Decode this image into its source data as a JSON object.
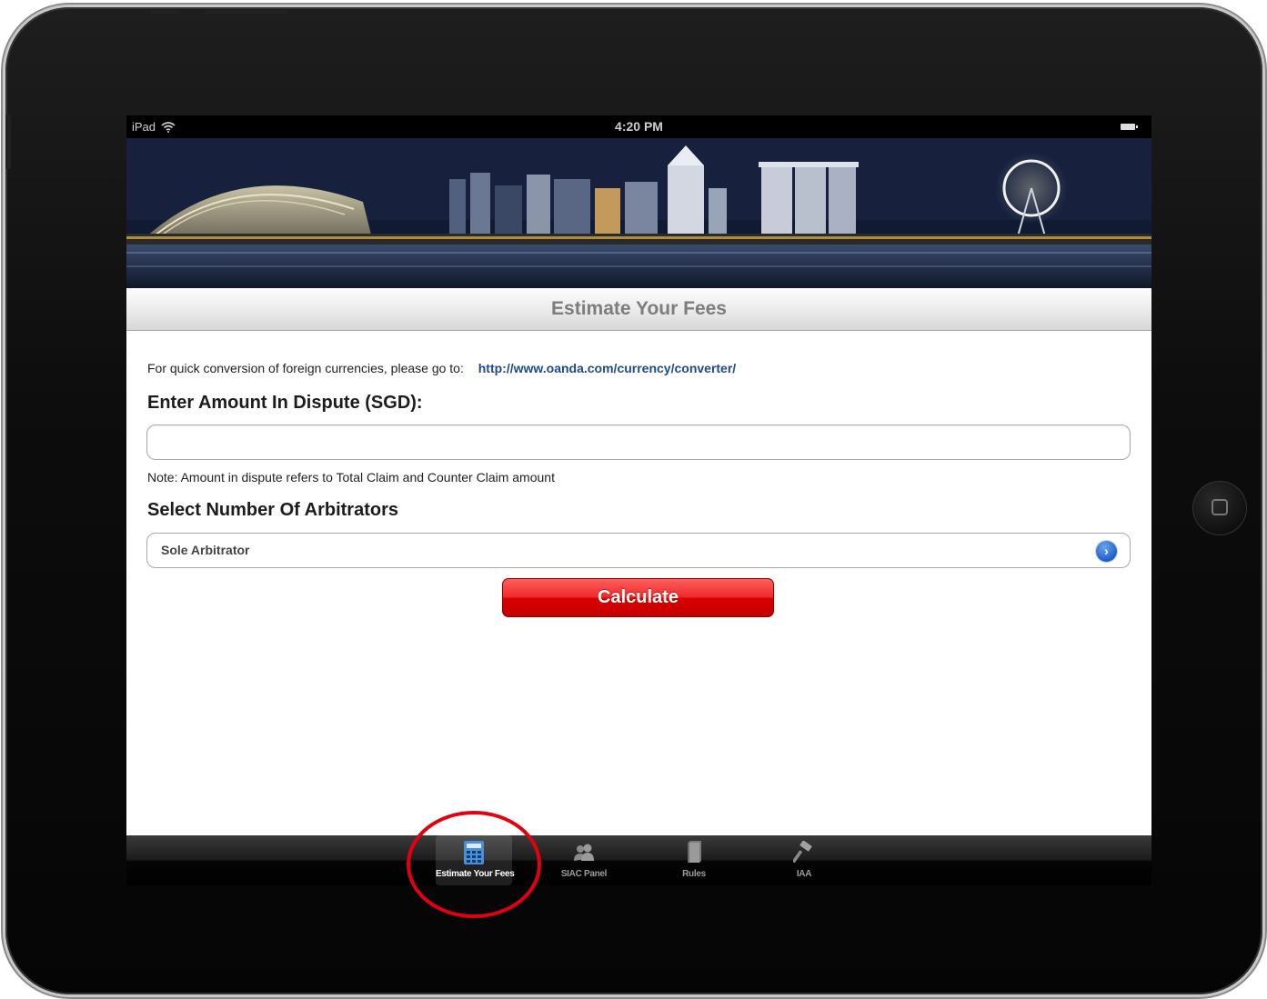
{
  "status_bar": {
    "carrier": "iPad",
    "time": "4:20 PM"
  },
  "header": {
    "title": "Estimate Your Fees"
  },
  "form": {
    "currency_note": "For quick conversion of foreign currencies, please go to:",
    "currency_link": "http://www.oanda.com/currency/converter/",
    "amount_heading": "Enter Amount In Dispute (SGD):",
    "amount_value": "",
    "amount_placeholder": "",
    "amount_note": "Note: Amount in dispute refers to Total Claim and Counter Claim amount",
    "arbitrators_heading": "Select Number Of Arbitrators",
    "arbitrators_value": "Sole Arbitrator",
    "calculate_label": "Calculate"
  },
  "tabs": [
    {
      "label": "Estimate Your Fees",
      "icon": "calculator-icon",
      "active": true
    },
    {
      "label": "SIAC Panel",
      "icon": "people-icon",
      "active": false
    },
    {
      "label": "Rules",
      "icon": "book-icon",
      "active": false
    },
    {
      "label": "IAA",
      "icon": "gavel-icon",
      "active": false
    }
  ],
  "colors": {
    "accent_red": "#d90000",
    "link_blue": "#1f4a8c",
    "highlight_circle": "#e3000f"
  }
}
